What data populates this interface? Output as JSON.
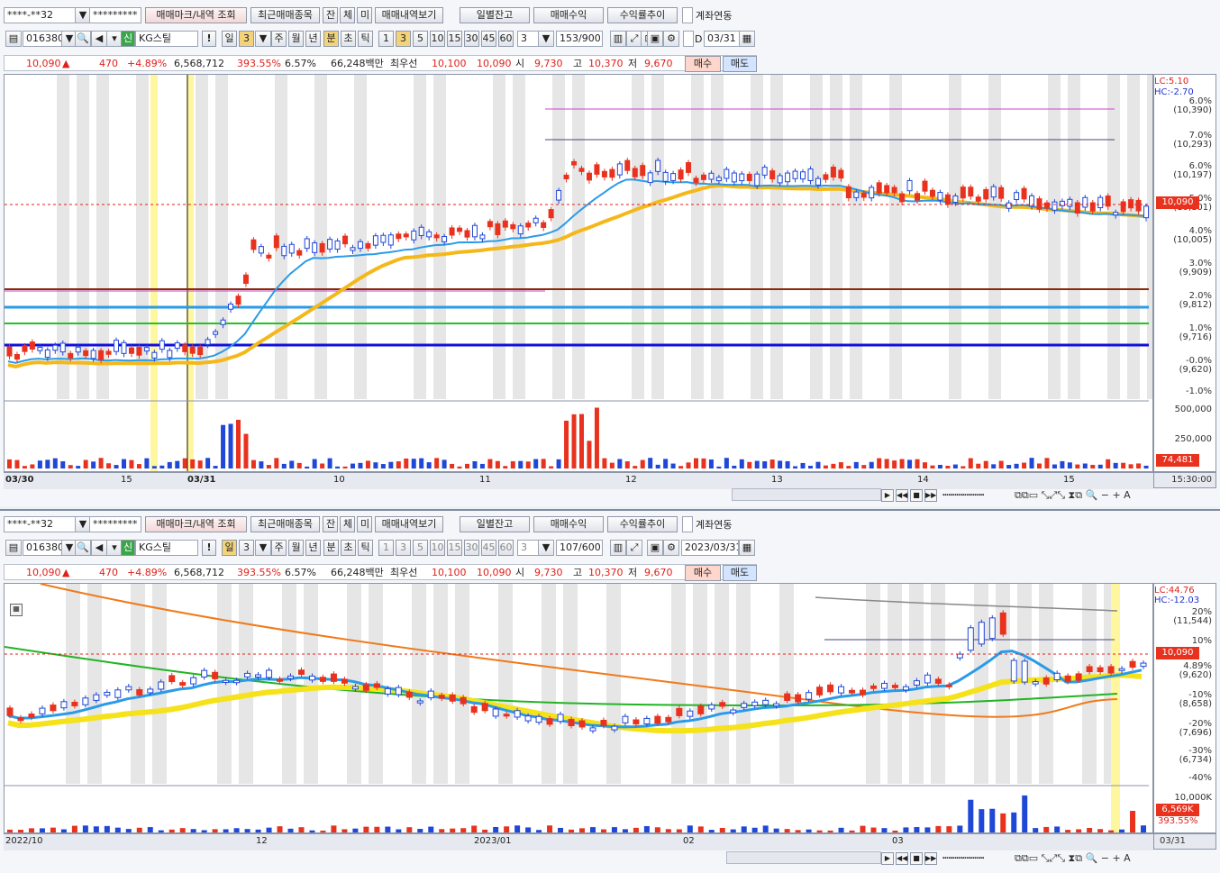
{
  "panel1": {
    "account_masked": "****-**32",
    "password_masked": "*********",
    "menu_buttons": [
      "매매마크/내역 조회",
      "최근매매종목",
      "잔",
      "체",
      "미",
      "매매내역보기"
    ],
    "right_buttons": [
      "일별잔고",
      "매매수익",
      "수익률추이"
    ],
    "account_link_label": "계좌연동",
    "stock_code": "016380",
    "credit_label": "신",
    "stock_name": "KG스틸",
    "alert_label": "!",
    "period_day": "일",
    "period_value": "3",
    "periods": [
      "주",
      "월",
      "년",
      "분",
      "초",
      "틱"
    ],
    "active_period": "분",
    "minute_options": [
      "1",
      "3",
      "5",
      "10",
      "15",
      "30",
      "45",
      "60"
    ],
    "active_minute": "3",
    "interval_value": "3",
    "count_display": "153/900",
    "date_label": "D",
    "date_value": "03/31",
    "quote": {
      "price": "10,090",
      "change": "470",
      "change_pct": "+4.89%",
      "volume": "6,568,712",
      "vol_ratio": "393.55%",
      "turnover": "6.57%",
      "amount": "66,248백만",
      "best_label": "최우선",
      "ask": "10,100",
      "bid": "10,090",
      "open_label": "시",
      "open": "9,730",
      "high_label": "고",
      "high": "10,370",
      "low_label": "저",
      "low": "9,670",
      "buy_label": "매수",
      "sell_label": "매도"
    },
    "y_axis": {
      "lc": "LC:5.10",
      "hc": "HC:-2.70",
      "ticks": [
        {
          "pct": "6.0%",
          "price": "(10,390)"
        },
        {
          "pct": "7.0%",
          "price": "(10,293)"
        },
        {
          "pct": "6.0%",
          "price": "(10,197)"
        },
        {
          "pct": "5.0%",
          "price": "(10,101)"
        },
        {
          "pct": "4.0%",
          "price": "(10,005)"
        },
        {
          "pct": "3.0%",
          "price": "(9,909)"
        },
        {
          "pct": "2.0%",
          "price": "(9,812)"
        },
        {
          "pct": "1.0%",
          "price": "(9,716)"
        },
        {
          "pct": "-0.0%",
          "price": "(9,620)"
        },
        {
          "pct": "-1.0%",
          "price": ""
        }
      ],
      "current_price_tag": "10,090",
      "volume_ticks": [
        "500,000",
        "250,000"
      ],
      "volume_tag": "74,481",
      "time_label": "15:30:00"
    },
    "x_axis": [
      "03/30",
      "15",
      "03/31",
      "10",
      "11",
      "12",
      "13",
      "14",
      "15"
    ]
  },
  "panel2": {
    "account_masked": "****-**32",
    "password_masked": "*********",
    "menu_buttons": [
      "매매마크/내역 조회",
      "최근매매종목",
      "잔",
      "체",
      "미",
      "매매내역보기"
    ],
    "right_buttons": [
      "일별잔고",
      "매매수익",
      "수익률추이"
    ],
    "account_link_label": "계좌연동",
    "stock_code": "016380",
    "credit_label": "신",
    "stock_name": "KG스틸",
    "alert_label": "!",
    "period_day": "일",
    "period_value": "3",
    "periods": [
      "주",
      "월",
      "년",
      "분",
      "초",
      "틱"
    ],
    "minute_options": [
      "1",
      "3",
      "5",
      "10",
      "15",
      "30",
      "45",
      "60"
    ],
    "interval_value": "3",
    "count_display": "107/600",
    "date_value": "2023/03/31",
    "quote": {
      "price": "10,090",
      "change": "470",
      "change_pct": "+4.89%",
      "volume": "6,568,712",
      "vol_ratio": "393.55%",
      "turnover": "6.57%",
      "amount": "66,248백만",
      "best_label": "최우선",
      "ask": "10,100",
      "bid": "10,090",
      "open_label": "시",
      "open": "9,730",
      "high_label": "고",
      "high": "10,370",
      "low_label": "저",
      "low": "9,670",
      "buy_label": "매수",
      "sell_label": "매도"
    },
    "y_axis": {
      "lc": "LC:44.76",
      "hc": "HC:-12.03",
      "ticks": [
        {
          "pct": "20%",
          "price": "(11,544)"
        },
        {
          "pct": "10%",
          "price": ""
        },
        {
          "pct": "4.89%",
          "price": "(9,620)"
        },
        {
          "pct": "-10%",
          "price": "(8,658)"
        },
        {
          "pct": "-20%",
          "price": "(7,696)"
        },
        {
          "pct": "-30%",
          "price": "(6,734)"
        },
        {
          "pct": "-40%",
          "price": ""
        }
      ],
      "current_price_tag": "10,090",
      "volume_ticks": [
        "10,000K"
      ],
      "volume_tag": "6,569K",
      "volume_pct": "393.55%",
      "date_label": "03/31"
    },
    "x_axis": [
      "2022/10",
      "12",
      "2023/01",
      "02",
      "03"
    ]
  },
  "colors": {
    "up": "#e8321e",
    "down": "#1f47d8",
    "ma_yellow": "#f5e21a",
    "ma_blue": "#2a9be8",
    "cloud": "#c9eefa",
    "highlight": "#fff7a0",
    "shade": "#e6e6e6"
  }
}
